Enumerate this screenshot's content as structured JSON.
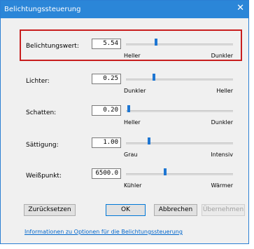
{
  "window": {
    "title": "Belichtungssteuerung",
    "close_glyph": "✕",
    "accent_color": "#2b86d8"
  },
  "controls": [
    {
      "label": "Belichtungswert:",
      "value": "5.54",
      "slider_fraction": 0.27,
      "low": "Heller",
      "high": "Dunkler"
    },
    {
      "label": "Lichter:",
      "value": "0.25",
      "slider_fraction": 0.25,
      "low": "Dunkler",
      "high": "Heller"
    },
    {
      "label": "Schatten:",
      "value": "0.20",
      "slider_fraction": 0.01,
      "low": "Heller",
      "high": "Dunkler"
    },
    {
      "label": "Sättigung:",
      "value": "1.00",
      "slider_fraction": 0.2,
      "low": "Grau",
      "high": "Intensiv"
    },
    {
      "label": "Weißpunkt:",
      "value": "6500.0",
      "slider_fraction": 0.35,
      "low": "Kühler",
      "high": "Wärmer"
    }
  ],
  "buttons": {
    "reset": "Zurücksetzen",
    "ok": "OK",
    "cancel": "Abbrechen",
    "apply": "Übernehmen"
  },
  "help_link": "Informationen zu Optionen für die Belichtungssteuerung"
}
